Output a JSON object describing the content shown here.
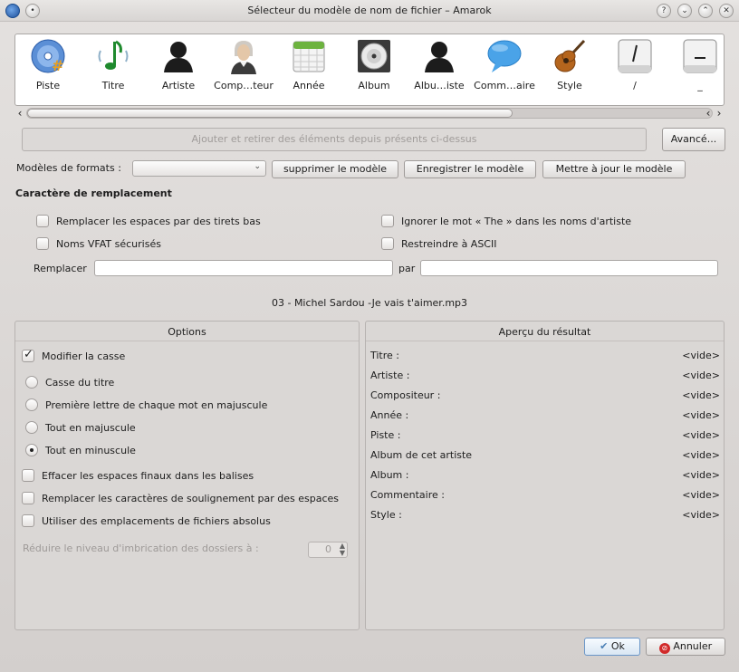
{
  "window": {
    "title": "Sélecteur du modèle de nom de fichier – Amarok",
    "buttons": [
      "?",
      "⌄",
      "⌃",
      "✕"
    ]
  },
  "tokens": [
    {
      "label": "Piste",
      "icon": "cd-track-icon"
    },
    {
      "label": "Titre",
      "icon": "music-note-icon"
    },
    {
      "label": "Artiste",
      "icon": "artist-silhouette-icon"
    },
    {
      "label": "Comp…teur",
      "icon": "composer-portrait-icon"
    },
    {
      "label": "Année",
      "icon": "calendar-icon"
    },
    {
      "label": "Album",
      "icon": "album-disc-icon"
    },
    {
      "label": "Albu…iste",
      "icon": "album-artist-silhouette-icon"
    },
    {
      "label": "Comm…aire",
      "icon": "speech-bubble-icon"
    },
    {
      "label": "Style",
      "icon": "guitar-icon"
    },
    {
      "label": "/",
      "icon": "slash-key-icon"
    },
    {
      "label": "_",
      "icon": "underscore-key-icon"
    }
  ],
  "drop_area_text": "Ajouter et retirer des éléments depuis présents ci-dessus",
  "advanced_button": "Avancé...",
  "formats": {
    "label": "Modèles de formats :",
    "selected": "",
    "delete_button": "supprimer le modèle",
    "save_button": "Enregistrer le modèle",
    "update_button": "Mettre à jour le modèle"
  },
  "replacement": {
    "heading": "Caractère de remplacement",
    "spaces_to_underscores": "Remplacer les espaces par des tirets bas",
    "ignore_the": "Ignorer le mot « The » dans les noms d'artiste",
    "vfat_safe": "Noms VFAT sécurisés",
    "ascii_only": "Restreindre à ASCII",
    "replace_label": "Remplacer",
    "replace_value": "",
    "with_label": "par",
    "with_value": ""
  },
  "filename_preview": "03 - Michel Sardou -Je vais t'aimer.mp3",
  "options": {
    "title": "Options",
    "modify_case": "Modifier la casse",
    "title_case": "Casse du titre",
    "first_letter": "Première lettre de chaque mot en majuscule",
    "all_upper": "Tout en majuscule",
    "all_lower": "Tout en minuscule",
    "trim_spaces": "Effacer les espaces finaux dans les balises",
    "underscores_to_spaces": "Remplacer les caractères de soulignement par des espaces",
    "absolute_paths": "Utiliser des emplacements de fichiers absolus",
    "reduce_nesting_label": "Réduire le niveau d'imbrication des dossiers à :",
    "reduce_nesting_value": "0"
  },
  "result": {
    "title": "Aperçu du résultat",
    "rows": [
      {
        "key": "Titre :",
        "value": "<vide>"
      },
      {
        "key": "Artiste :",
        "value": "<vide>"
      },
      {
        "key": "Compositeur :",
        "value": "<vide>"
      },
      {
        "key": "Année :",
        "value": "<vide>"
      },
      {
        "key": "Piste :",
        "value": "<vide>"
      },
      {
        "key": "Album de cet artiste",
        "value": "<vide>"
      },
      {
        "key": "Album :",
        "value": "<vide>"
      },
      {
        "key": "Commentaire :",
        "value": "<vide>"
      },
      {
        "key": "Style :",
        "value": "<vide>"
      }
    ]
  },
  "footer": {
    "ok": "Ok",
    "cancel": "Annuler"
  }
}
